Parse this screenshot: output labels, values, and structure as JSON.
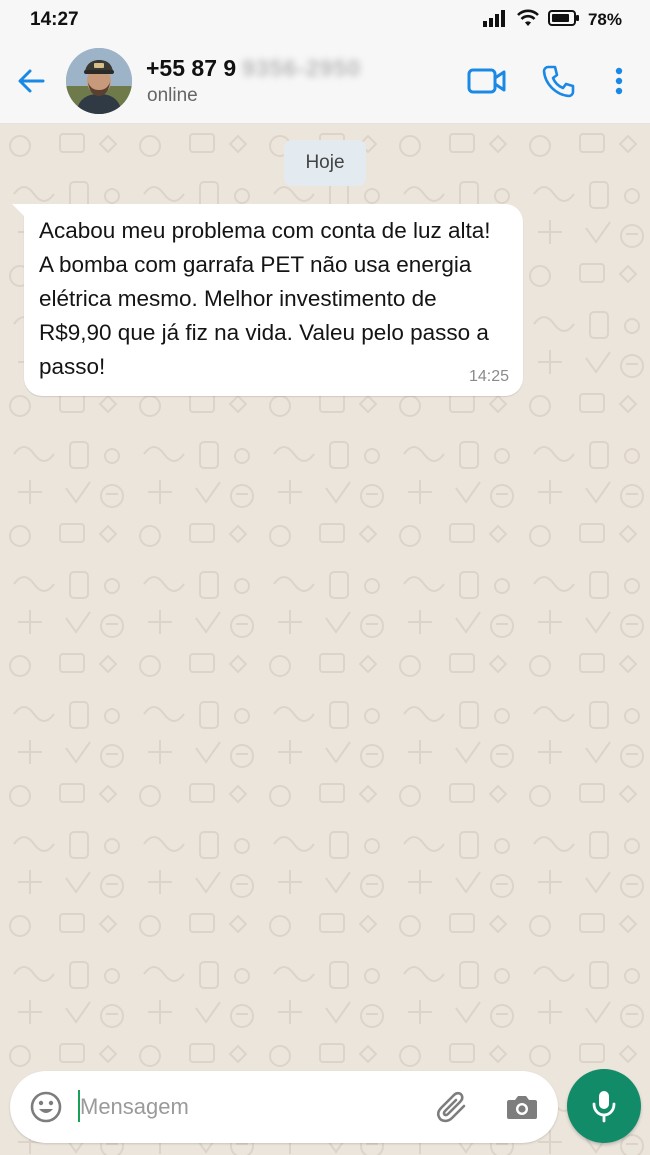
{
  "status_bar": {
    "time": "14:27",
    "battery": "78%"
  },
  "header": {
    "contact_name": "+55 87 9",
    "contact_name_hidden": "9356-2950",
    "status": "online"
  },
  "chat": {
    "date_label": "Hoje",
    "messages": [
      {
        "text": "Acabou meu problema com conta de luz alta! A bomba com garrafa PET não usa energia elétrica mesmo. Melhor investimento de R$9,90 que já fiz na vida. Valeu pelo passo a passo!",
        "time": "14:25"
      }
    ]
  },
  "composer": {
    "placeholder": "Mensagem"
  },
  "icons": {
    "back": "arrow-left-icon",
    "video": "video-camera-icon",
    "call": "phone-icon",
    "menu": "more-vert-icon",
    "emoji": "emoji-icon",
    "attach": "paperclip-icon",
    "camera": "camera-icon",
    "mic": "microphone-icon"
  },
  "colors": {
    "accent_blue": "#1a88e5",
    "mic_green": "#128c68",
    "chat_background": "#ece5dc",
    "date_chip": "#e3ebf1"
  }
}
